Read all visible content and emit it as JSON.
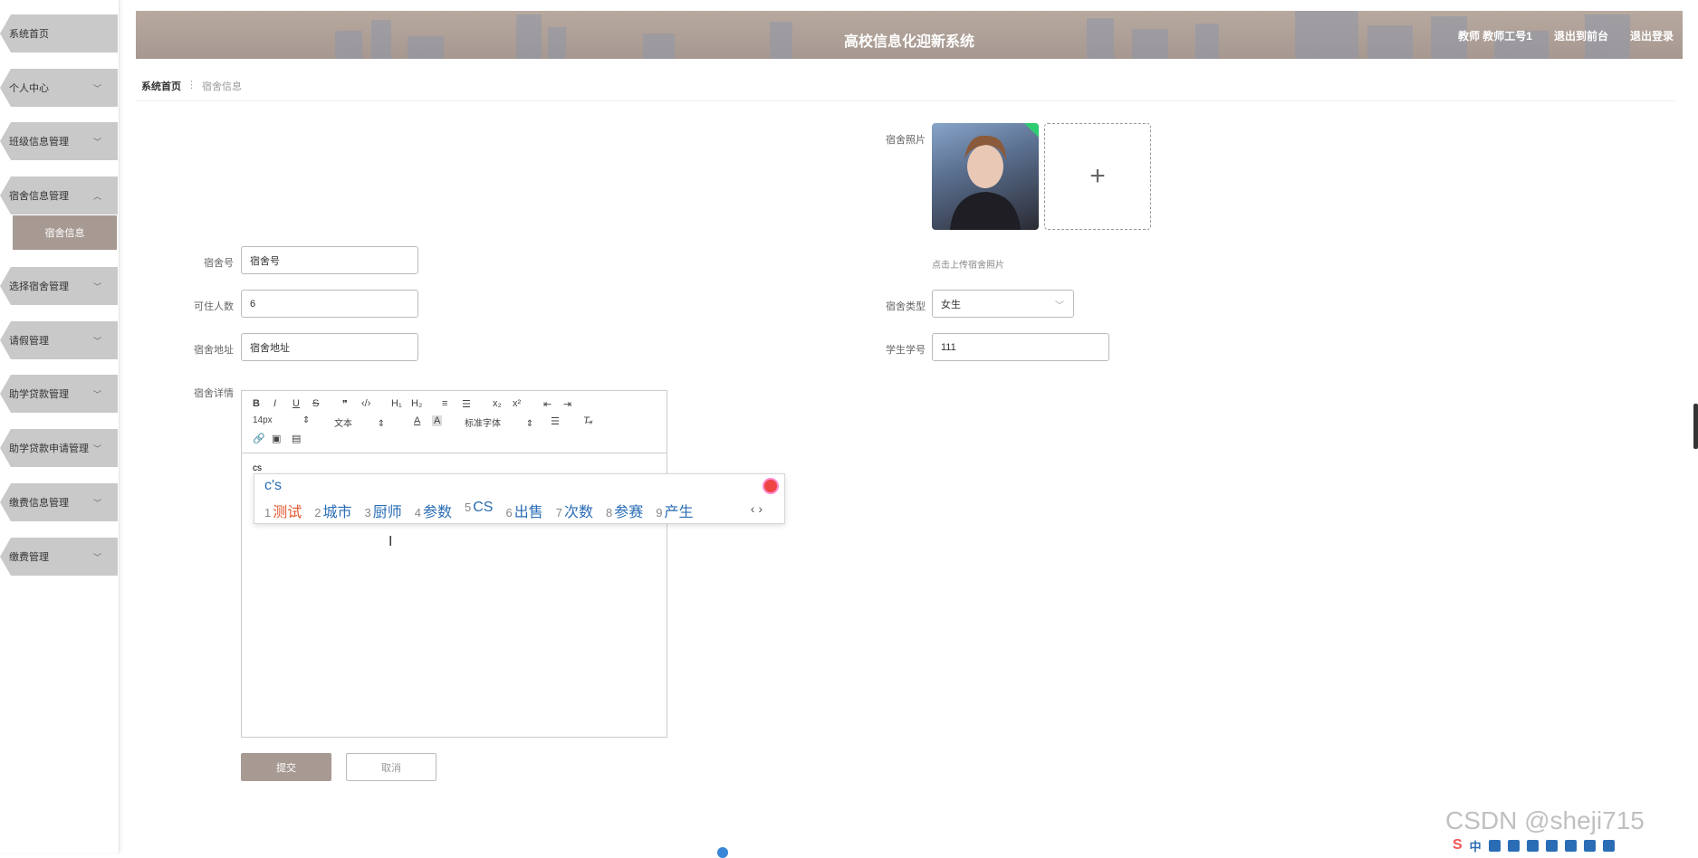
{
  "sidebar": {
    "items": [
      {
        "label": "系统首页",
        "chevron": ""
      },
      {
        "label": "个人中心",
        "chevron": "﹀"
      },
      {
        "label": "班级信息管理",
        "chevron": "﹀"
      },
      {
        "label": "宿舍信息管理",
        "chevron": "︿"
      },
      {
        "label": "选择宿舍管理",
        "chevron": "﹀"
      },
      {
        "label": "请假管理",
        "chevron": "﹀"
      },
      {
        "label": "助学贷款管理",
        "chevron": "﹀"
      },
      {
        "label": "助学贷款申请管理",
        "chevron": "﹀"
      },
      {
        "label": "缴费信息管理",
        "chevron": "﹀"
      },
      {
        "label": "缴费管理",
        "chevron": "﹀"
      }
    ],
    "sub_item": "宿舍信息"
  },
  "header": {
    "title": "高校信息化迎新系统",
    "user": "教师 教师工号1",
    "exit_front": "退出到前台",
    "logout": "退出登录"
  },
  "breadcrumb": {
    "home": "系统首页",
    "sep": "⋮",
    "current": "宿舍信息"
  },
  "form": {
    "dorm_no_label": "宿舍号",
    "dorm_no_value": "宿舍号",
    "capacity_label": "可住人数",
    "capacity_value": "6",
    "address_label": "宿舍地址",
    "address_value": "宿舍地址",
    "photo_label": "宿舍照片",
    "upload_plus": "+",
    "upload_tip": "点击上传宿舍照片",
    "type_label": "宿舍类型",
    "type_value": "女生",
    "student_no_label": "学生学号",
    "student_no_value": "111",
    "detail_label": "宿舍详情"
  },
  "editor": {
    "toolbar_row1": [
      "B",
      "I",
      "U",
      "S",
      "❞",
      "‹/›",
      "H₁",
      "H₂",
      "≡",
      "☰",
      "x₂",
      "x²",
      "⇤",
      "⇥"
    ],
    "font_size": "14px",
    "text_type": "文本",
    "font_family": "标准字体",
    "content": "cs"
  },
  "ime": {
    "pinyin": "c's",
    "candidates": [
      {
        "num": "1",
        "text": "测试"
      },
      {
        "num": "2",
        "text": "城市"
      },
      {
        "num": "3",
        "text": "厨师"
      },
      {
        "num": "4",
        "text": "参数"
      },
      {
        "num": "5",
        "text": "CS"
      },
      {
        "num": "6",
        "text": "出售"
      },
      {
        "num": "7",
        "text": "次数"
      },
      {
        "num": "8",
        "text": "参赛"
      },
      {
        "num": "9",
        "text": "产生"
      }
    ],
    "nav": "‹ ›"
  },
  "buttons": {
    "submit": "提交",
    "cancel": "取消"
  },
  "watermark": "CSDN @sheji715",
  "tray": {
    "ime_label": "中"
  },
  "colors": {
    "accent": "#a79a93",
    "header": "#b0a39a",
    "sidebar_item": "#c9c9c9"
  }
}
